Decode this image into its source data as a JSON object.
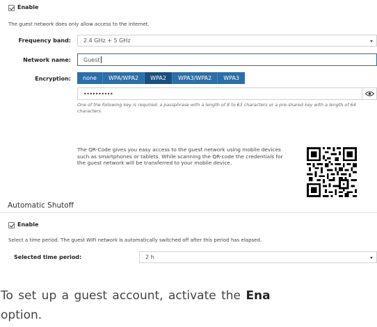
{
  "guest": {
    "enable_label": "Enable",
    "enabled": true,
    "description": "The guest network does only allow access to the internet.",
    "frequency_label": "Frequency band:",
    "frequency_value": "2.4 GHz + 5 GHz",
    "network_label": "Network name:",
    "network_value": "Guest",
    "encryption_label": "Encryption:",
    "encryption_options": [
      "none",
      "WPA/WPA2",
      "WPA2",
      "WPA3/WPA2",
      "WPA3"
    ],
    "encryption_selected": "WPA2",
    "password_mask": "••••••••••",
    "key_note": "One of the following key is required: a passphrase with a length of 8 to 63 characters or a pre-shared key with a length of 64 characters.",
    "qr_text": "The QR-Code gives you easy access to the guest network using mobile devices such as smartphones or tablets. While scanning the QR-code the credentials for the guest network will be transferred to your mobile device."
  },
  "shutoff": {
    "heading": "Automatic Shutoff",
    "enable_label": "Enable",
    "enabled": true,
    "description": "Select a time period. The guest WiFi network is automatically switched off after this period has elapsed.",
    "period_label": "Selected time period:",
    "period_value": "2 h"
  },
  "instruction": {
    "prefix": "To set up a guest account, activate the ",
    "bold": "Ena",
    "line2": "option."
  },
  "icons": {
    "eye": "eye-icon",
    "dropdown": "chevron-down-icon",
    "qr": "qr-code-image"
  },
  "colors": {
    "accent": "#2b6ea9",
    "accent_active": "#1a4f80",
    "focus_border": "#2c6aa0"
  }
}
